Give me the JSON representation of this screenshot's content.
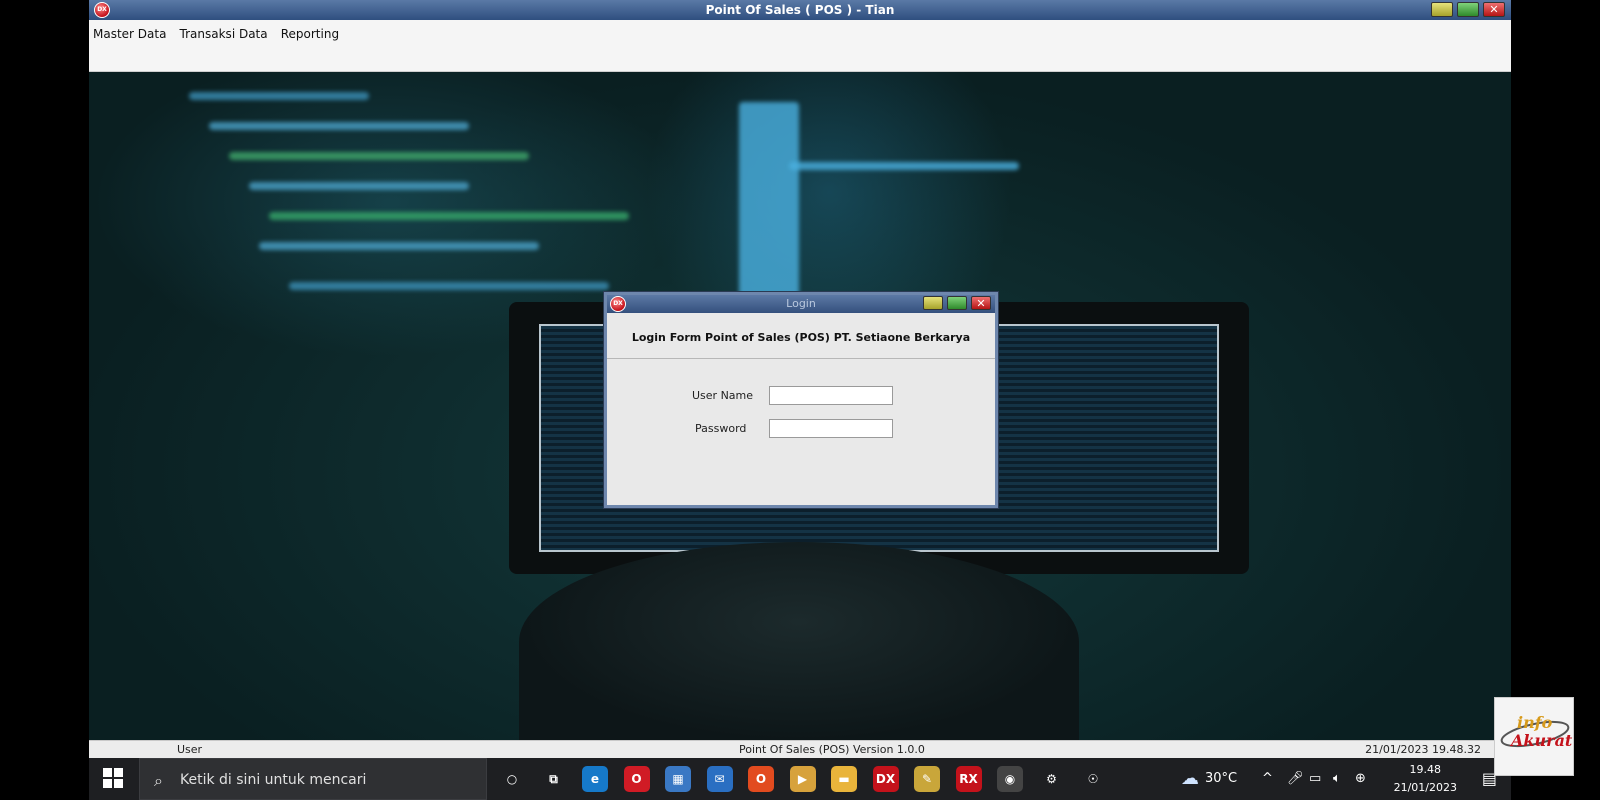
{
  "app": {
    "title": "Point Of Sales ( POS ) - Tian",
    "logo_text": "DX"
  },
  "menubar": {
    "items": [
      {
        "label": "Master Data"
      },
      {
        "label": "Transaksi Data"
      },
      {
        "label": "Reporting"
      }
    ]
  },
  "login": {
    "title": "Login",
    "header": "Login Form Point of Sales (POS) PT. Setiaone Berkarya",
    "username_label": "User Name",
    "username_value": "",
    "password_label": "Password",
    "password_value": ""
  },
  "statusbar": {
    "left": "User",
    "center": "Point Of Sales (POS) Version 1.0.0",
    "right": "21/01/2023 19.48.32"
  },
  "taskbar": {
    "search_placeholder": "Ketik di sini untuk mencari",
    "pinned": [
      {
        "name": "cortana-icon",
        "glyph": "○",
        "color": "transparent"
      },
      {
        "name": "task-view-icon",
        "glyph": "⧉",
        "color": "transparent"
      },
      {
        "name": "edge-icon",
        "glyph": "e",
        "color": "#1679c9"
      },
      {
        "name": "opera-icon",
        "glyph": "O",
        "color": "#d01b25"
      },
      {
        "name": "store-icon",
        "glyph": "▦",
        "color": "#3a78c4"
      },
      {
        "name": "mail-icon",
        "glyph": "✉",
        "color": "#2a6fc2"
      },
      {
        "name": "office-icon",
        "glyph": "O",
        "color": "#e24b1f"
      },
      {
        "name": "media-icon",
        "glyph": "▶",
        "color": "#d7a23c"
      },
      {
        "name": "explorer-icon",
        "glyph": "▬",
        "color": "#e9b43b"
      },
      {
        "name": "dx-app-icon",
        "glyph": "DX",
        "color": "#c4121b"
      },
      {
        "name": "notes-icon",
        "glyph": "✎",
        "color": "#c9a63a"
      },
      {
        "name": "rx-icon",
        "glyph": "RX",
        "color": "#c4121b"
      },
      {
        "name": "record-icon",
        "glyph": "◉",
        "color": "#444"
      },
      {
        "name": "settings-icon",
        "glyph": "⚙",
        "color": "transparent"
      },
      {
        "name": "people-icon",
        "glyph": "☉",
        "color": "transparent"
      }
    ],
    "temperature": "30°C",
    "time": "19.48",
    "date": "21/01/2023"
  }
}
